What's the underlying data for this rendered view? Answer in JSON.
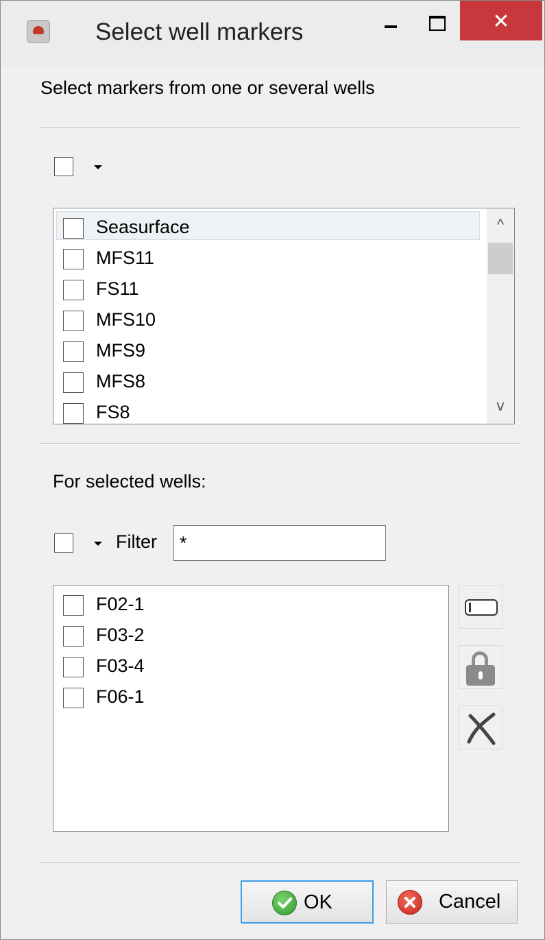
{
  "window": {
    "title": "Select well markers",
    "close_glyph": "✕",
    "icon": "app-icon"
  },
  "subtitle": "Select markers from one or several wells",
  "markers": {
    "items": [
      {
        "label": "Seasurface",
        "checked": false
      },
      {
        "label": "MFS11",
        "checked": false
      },
      {
        "label": "FS11",
        "checked": false
      },
      {
        "label": "MFS10",
        "checked": false
      },
      {
        "label": "MFS9",
        "checked": false
      },
      {
        "label": "MFS8",
        "checked": false
      },
      {
        "label": "FS8",
        "checked": false
      }
    ],
    "scroll_up_glyph": "^",
    "scroll_down_glyph": "v"
  },
  "wells_section": {
    "label": "For selected wells:",
    "filter_label": "Filter",
    "filter_value": "*",
    "items": [
      {
        "label": "F02-1",
        "checked": false
      },
      {
        "label": "F03-2",
        "checked": false
      },
      {
        "label": "F03-4",
        "checked": false
      },
      {
        "label": "F06-1",
        "checked": false
      }
    ]
  },
  "buttons": {
    "ok": "OK",
    "cancel": "Cancel"
  }
}
